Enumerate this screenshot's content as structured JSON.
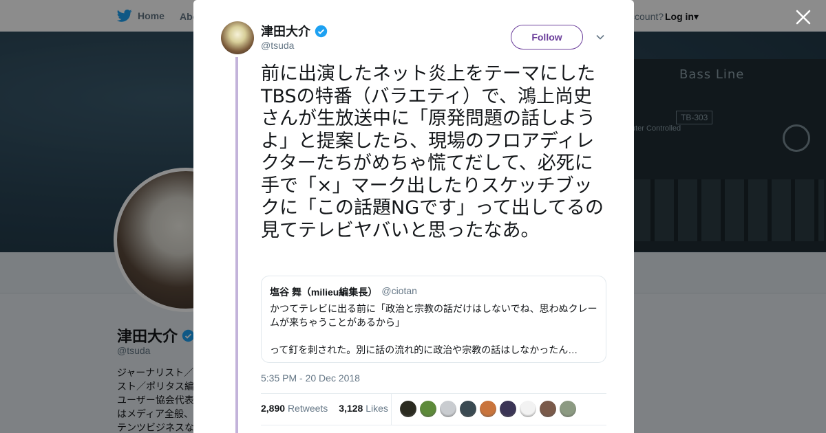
{
  "background": {
    "nav": {
      "home_label": "Home",
      "about_label": "Abo",
      "account_prompt": "ccount?",
      "login_label": "Log in"
    },
    "banner": {
      "device_brand": "Bass Line",
      "device_model": "TB-303",
      "device_subtitle": "uter Controlled"
    },
    "profile": {
      "name": "津田大介",
      "handle": "@tsuda",
      "bio_lines": [
        "ジャーナリスト／",
        "スト／ポリタス編",
        "ユーザー協会代表",
        "はメディア全般、",
        "テンツビジネスな"
      ]
    }
  },
  "modal": {
    "author": {
      "name": "津田大介",
      "handle": "@tsuda",
      "follow_label": "Follow"
    },
    "tweet_text": "前に出演したネット炎上をテーマにしたTBSの特番（バラエティ）で、鴻上尚史さんが生放送中に「原発問題の話しようよ」と提案したら、現場のフロアディレクターたちがめちゃ慌てだして、必死に手で「×」マーク出したりスケッチブックに「この話題NGです」って出してるの見てテレビヤバいと思ったなあ。",
    "quote": {
      "name": "塩谷 舞（milieu編集長）",
      "handle": "@ciotan",
      "line1": "かつてテレビに出る前に「政治と宗教の話だけはしないでね、思わぬクレー",
      "line2": "ムが来ちゃうことがあるから」",
      "line3": "",
      "line4": "って釘を刺された。別に話の流れ的に政治や宗教の話はしなかったん…"
    },
    "timestamp": "5:35 PM - 20 Dec 2018",
    "stats": {
      "retweets_count": "2,890",
      "retweets_label": "Retweets",
      "likes_count": "3,128",
      "likes_label": "Likes"
    },
    "likers": [
      {
        "icon": "liker-avatar",
        "color": "#2b2b20"
      },
      {
        "icon": "liker-avatar",
        "color": "#5d8a3a"
      },
      {
        "icon": "liker-avatar",
        "color": "#c9ccd0"
      },
      {
        "icon": "liker-avatar",
        "color": "#3a4a52"
      },
      {
        "icon": "liker-avatar",
        "color": "#c9743c"
      },
      {
        "icon": "liker-avatar",
        "color": "#3b3556"
      },
      {
        "icon": "liker-avatar",
        "color": "#f2f2f2"
      },
      {
        "icon": "liker-avatar",
        "color": "#7a5a4a"
      },
      {
        "icon": "liker-avatar",
        "color": "#8c9a82"
      }
    ]
  },
  "colors": {
    "accent": "#6a3d9a",
    "verified": "#1da1f2",
    "thread_line": "#c3b3da"
  }
}
